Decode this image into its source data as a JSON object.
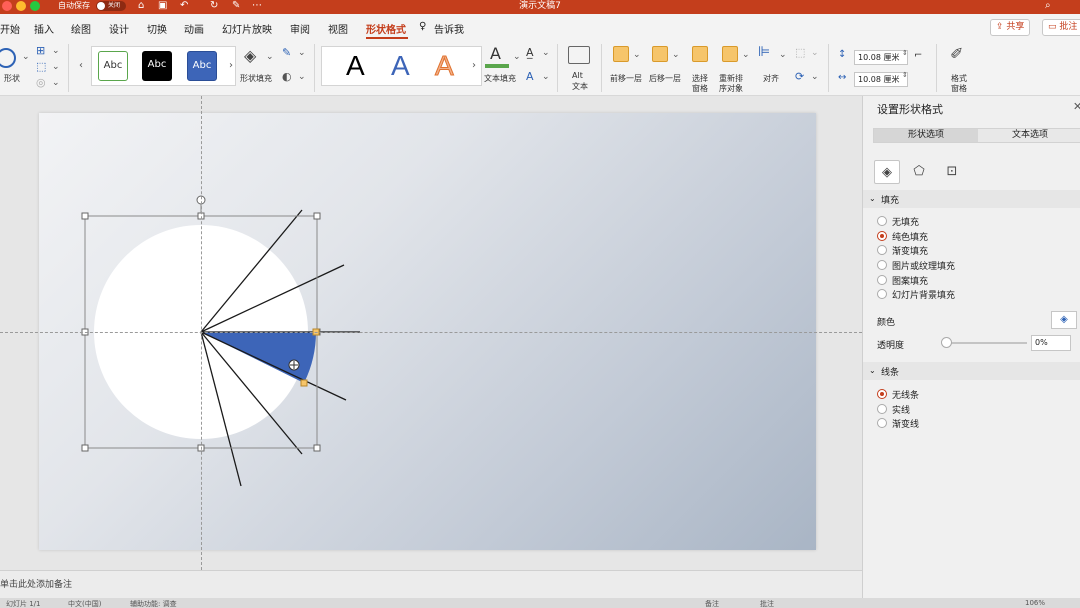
{
  "titlebar": {
    "autosave_label": "自动保存",
    "toggle_label": "关闭",
    "doc_title": "演示文稿7"
  },
  "tabs": [
    {
      "label": "开始"
    },
    {
      "label": "插入"
    },
    {
      "label": "绘图"
    },
    {
      "label": "设计"
    },
    {
      "label": "切换"
    },
    {
      "label": "动画"
    },
    {
      "label": "幻灯片放映"
    },
    {
      "label": "审阅"
    },
    {
      "label": "视图"
    },
    {
      "label": "形状格式"
    },
    {
      "label": "告诉我"
    }
  ],
  "active_tab": "形状格式",
  "share": {
    "share_label": "共享",
    "comment_label": "批注"
  },
  "ribbon": {
    "shape_label": "形状",
    "style_swatches": [
      "Abc",
      "Abc",
      "Abc"
    ],
    "shape_fill_label": "形状填充",
    "wordart_letters": [
      "A",
      "A",
      "A"
    ],
    "text_fill_label": "文本填充",
    "alt_text_label": "Alt\n文本",
    "alt_label_line1": "Alt",
    "alt_label_line2": "文本",
    "forward_label": "前移一层",
    "backward_label": "后移一层",
    "select_pane_line1": "选择",
    "select_pane_line2": "窗格",
    "reorder_line1": "重新排",
    "reorder_line2": "序对象",
    "align_label": "对齐",
    "height_value": "10.08 厘米",
    "width_value": "10.08 厘米",
    "format_pane_line1": "格式",
    "format_pane_line2": "窗格"
  },
  "notes_placeholder": "单击此处添加备注",
  "statusbar": {
    "slide_count": "幻灯片 1/1",
    "language": "中文(中国)",
    "accessibility": "辅助功能: 调查",
    "notes": "备注",
    "comments": "批注",
    "zoom": "106%"
  },
  "pane": {
    "title": "设置形状格式",
    "tab_shape": "形状选项",
    "tab_text": "文本选项",
    "fill_section": "填充",
    "fill_options": [
      "无填充",
      "纯色填充",
      "渐变填充",
      "图片或纹理填充",
      "图案填充",
      "幻灯片背景填充"
    ],
    "fill_selected": 1,
    "color_label": "颜色",
    "transparency_label": "透明度",
    "transparency_value": "0%",
    "transparency_fraction": 0,
    "line_section": "线条",
    "line_options": [
      "无线条",
      "实线",
      "渐变线"
    ],
    "line_selected": 0
  },
  "colors": {
    "accent": "#c43e1c",
    "sector_fill": "#3d65b8",
    "slide_gradient_dark": "#a9b5c5",
    "slide_gradient_light": "#f2f3f5"
  }
}
